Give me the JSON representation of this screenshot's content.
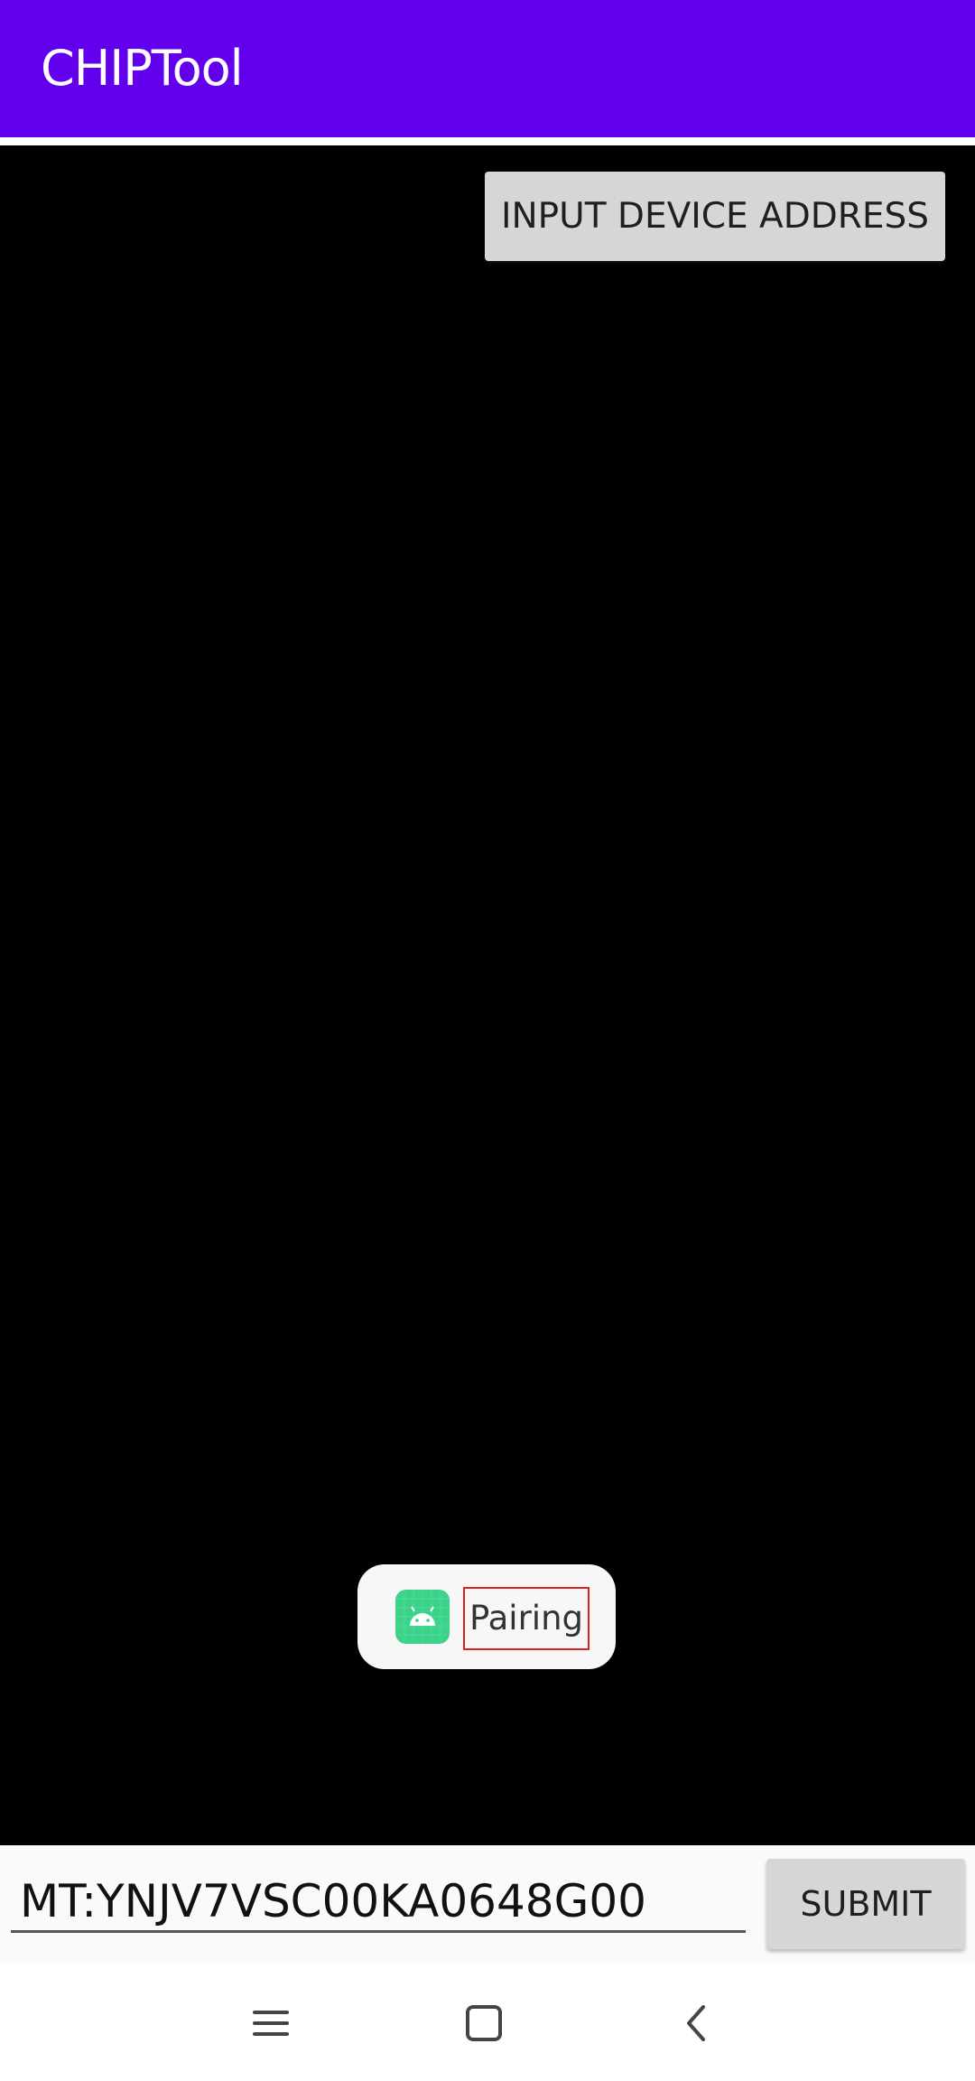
{
  "app_bar": {
    "title": "CHIPTool",
    "color": "#6200EE"
  },
  "actions": {
    "input_device_address_label": "INPUT DEVICE ADDRESS"
  },
  "toast": {
    "icon": "android-app-icon",
    "text": "Pairing"
  },
  "form": {
    "address_value": "MT:YNJV7VSC00KA0648G00",
    "submit_label": "SUBMIT"
  },
  "nav": {
    "items": [
      {
        "icon": "menu-icon"
      },
      {
        "icon": "home-icon"
      },
      {
        "icon": "back-icon"
      }
    ]
  }
}
